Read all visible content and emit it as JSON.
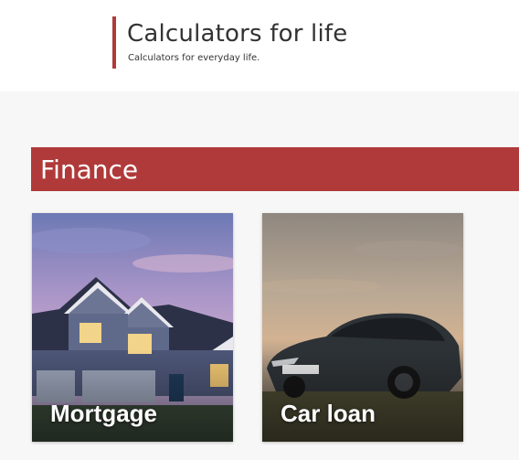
{
  "header": {
    "title": "Calculators for life",
    "tagline": "Calculators for everyday life.",
    "accent_color": "#b03a3a"
  },
  "sections": [
    {
      "title": "Finance",
      "cards": [
        {
          "label": "Mortgage",
          "image": "house-photo"
        },
        {
          "label": "Car loan",
          "image": "car-photo"
        }
      ]
    }
  ]
}
